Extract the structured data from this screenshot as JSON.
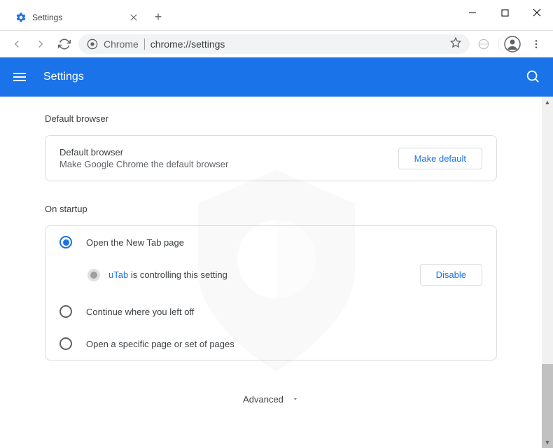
{
  "tab": {
    "title": "Settings"
  },
  "urlbar": {
    "prefix": "Chrome",
    "url": "chrome://settings"
  },
  "header": {
    "title": "Settings"
  },
  "sections": {
    "default_browser": {
      "heading": "Default browser",
      "row_title": "Default browser",
      "row_subtitle": "Make Google Chrome the default browser",
      "button": "Make default"
    },
    "on_startup": {
      "heading": "On startup",
      "options": [
        {
          "label": "Open the New Tab page",
          "selected": true
        },
        {
          "label": "Continue where you left off",
          "selected": false
        },
        {
          "label": "Open a specific page or set of pages",
          "selected": false
        }
      ],
      "controlled": {
        "ext_name": "uTab",
        "suffix": " is controlling this setting",
        "button": "Disable"
      }
    }
  },
  "advanced_label": "Advanced"
}
